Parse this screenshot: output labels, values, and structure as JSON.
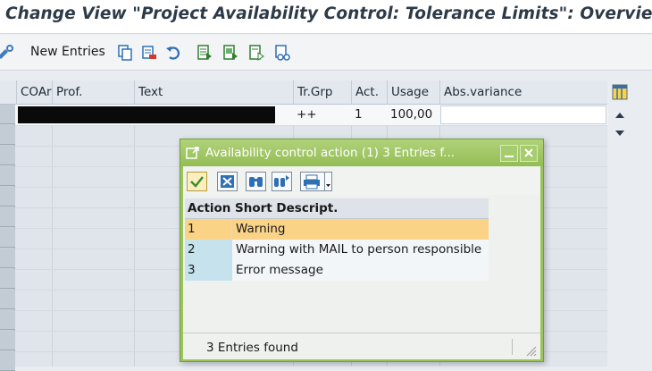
{
  "window": {
    "title": "Change View \"Project Availability Control: Tolerance Limits\": Overview"
  },
  "toolbar": {
    "new_entries_label": "New Entries",
    "icons": [
      "customizing-icon",
      "copy-icon",
      "delete-icon",
      "undo-icon",
      "select-all-icon",
      "select-block-icon",
      "deselect-all-icon",
      "glasses-icon"
    ]
  },
  "table": {
    "columns": [
      "COAr",
      "Prof.",
      "Text",
      "Tr.Grp",
      "Act.",
      "Usage",
      "Abs.variance"
    ],
    "rows": [
      {
        "coar": "",
        "prof": "",
        "text": "",
        "tr_grp": "++",
        "act": "1",
        "usage": "100,00",
        "abs_variance": ""
      }
    ]
  },
  "popup": {
    "title": "Availability control action (1)    3 Entries f...",
    "columns": [
      "Action",
      "Short Descript."
    ],
    "items": [
      {
        "action": "1",
        "description": "Warning",
        "selected": true
      },
      {
        "action": "2",
        "description": "Warning with MAIL to person responsible",
        "selected": false
      },
      {
        "action": "3",
        "description": "Error message",
        "selected": false
      }
    ],
    "status": "3 Entries found"
  },
  "colors": {
    "popup_green": "#9bc35d",
    "selection": "#fad387",
    "action_cell": "#c6e2ec"
  }
}
